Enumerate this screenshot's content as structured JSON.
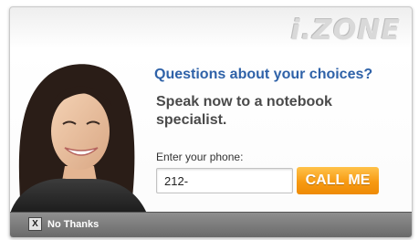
{
  "brand": {
    "logo_text": "i.ZONE"
  },
  "prompt": {
    "headline": "Questions about your choices?",
    "subline": "Speak now to a notebook specialist."
  },
  "phone": {
    "label": "Enter your phone:",
    "value": "212-"
  },
  "cta": {
    "call_label": "CALL ME"
  },
  "footer": {
    "close_icon": "close-icon",
    "close_glyph": "X",
    "no_thanks_label": "No Thanks"
  },
  "colors": {
    "headline": "#2f62a8",
    "button": "#f79a12",
    "footer_bar": "#7a7a7a"
  }
}
